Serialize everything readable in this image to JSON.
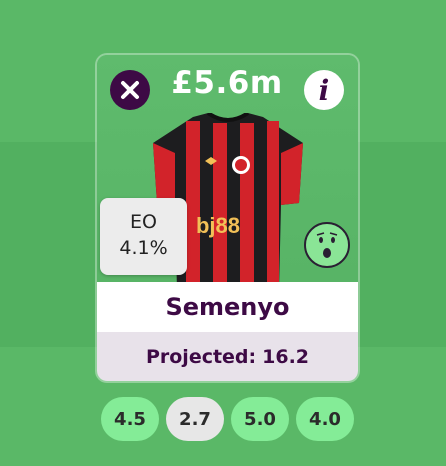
{
  "player_card": {
    "price": "£5.6m",
    "eo_label": "EO",
    "eo_value": "4.1%",
    "name": "Semenyo",
    "projected_label": "Projected:",
    "projected_value": "16.2",
    "shirt_sponsor": "bj88",
    "icons": {
      "close": "close-icon",
      "info": "info-icon",
      "shocked": "shocked-face-icon"
    }
  },
  "fixtures": [
    {
      "value": "4.5",
      "color": "#84ec97"
    },
    {
      "value": "2.7",
      "color": "#e7e7e7"
    },
    {
      "value": "5.0",
      "color": "#84ec97"
    },
    {
      "value": "4.0",
      "color": "#84ec97"
    }
  ],
  "colors": {
    "brand_purple": "#3d0a45",
    "pitch_green": "#52b060",
    "good_fixture": "#84ec97",
    "neutral_fixture": "#e7e7e7"
  }
}
